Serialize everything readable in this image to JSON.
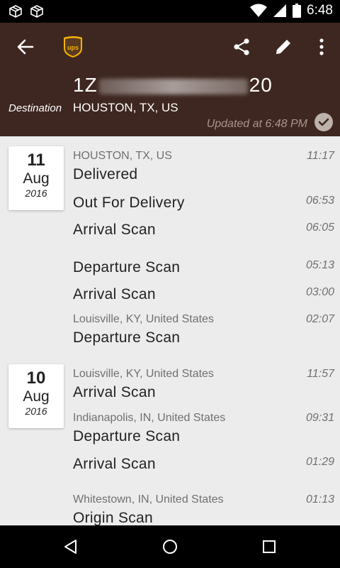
{
  "status_bar": {
    "time": "6:48"
  },
  "header": {
    "tracking_prefix": "1Z",
    "tracking_suffix": "20",
    "destination_label": "Destination",
    "destination_value": "HOUSTON, TX, US",
    "updated": "Updated at 6:48 PM"
  },
  "days": [
    {
      "day": "11",
      "month": "Aug",
      "year": "2016"
    },
    {
      "day": "10",
      "month": "Aug",
      "year": "2016"
    }
  ],
  "events": [
    {
      "location": "HOUSTON, TX, US",
      "status": "Delivered",
      "time": "11:17"
    },
    {
      "location": "",
      "status": "Out For Delivery",
      "time": "06:53"
    },
    {
      "location": "",
      "status": "Arrival Scan",
      "time": "06:05"
    },
    {
      "location": "",
      "status": "Departure Scan",
      "time": "05:13"
    },
    {
      "location": "",
      "status": "Arrival Scan",
      "time": "03:00"
    },
    {
      "location": "Louisville, KY, United States",
      "status": "Departure Scan",
      "time": "02:07"
    },
    {
      "location": "Louisville, KY, United States",
      "status": "Arrival Scan",
      "time": "11:57"
    },
    {
      "location": "Indianapolis, IN, United States",
      "status": "Departure Scan",
      "time": "09:31"
    },
    {
      "location": "",
      "status": "Arrival Scan",
      "time": "01:29"
    },
    {
      "location": "Whitestown, IN, United States",
      "status": "Origin Scan",
      "time": "01:13"
    }
  ]
}
